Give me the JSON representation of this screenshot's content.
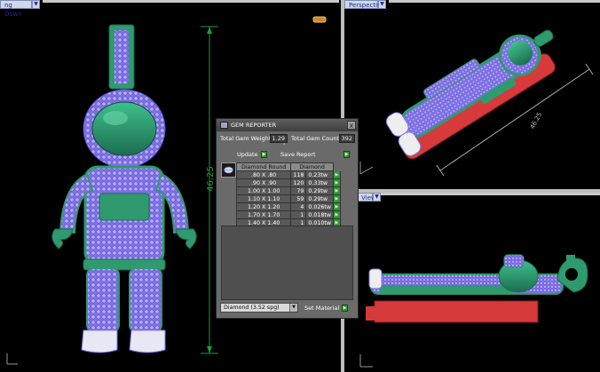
{
  "viewports": {
    "left": {
      "label": "ng Down",
      "dimension": "46.25"
    },
    "top_right": {
      "label": "Perspective",
      "dimension": "46.25"
    },
    "bottom_right": {
      "label": "View"
    }
  },
  "gem_reporter": {
    "title": "GEM REPORTER",
    "close_label": "x",
    "total_weight_label": "Total Gem Weight",
    "total_weight_value": "1.29",
    "total_count_label": "Total Gem Count",
    "total_count_value": "392",
    "update_label": "Update",
    "save_label": "Save Report",
    "columns": [
      "Diamond Round",
      "Diamond"
    ],
    "rows": [
      {
        "size": ".80 X .80",
        "count": "118",
        "weight": "0.23tw"
      },
      {
        "size": ".90 X .90",
        "count": "120",
        "weight": "0.33tw"
      },
      {
        "size": "1.00 X 1.00",
        "count": "79",
        "weight": "0.29tw"
      },
      {
        "size": "1.10 X 1.10",
        "count": "59",
        "weight": "0.29tw"
      },
      {
        "size": "1.20 X 1.20",
        "count": "4",
        "weight": "0.026tw"
      },
      {
        "size": "1.70 X 1.70",
        "count": "1",
        "weight": "0.018tw"
      },
      {
        "size": "1.40 X 1.40",
        "count": "1",
        "weight": "0.010tw"
      }
    ],
    "material_value": "Diamond   (3.52 spg)",
    "set_material_label": "Set Material"
  },
  "colors": {
    "gem": "#8f7ff2",
    "gem_light": "#b9b0ff",
    "metal": "#2f9a6e",
    "metal_dark": "#1d6b4c",
    "base_red": "#d63a3a",
    "dimension": "#1e9e3a"
  }
}
